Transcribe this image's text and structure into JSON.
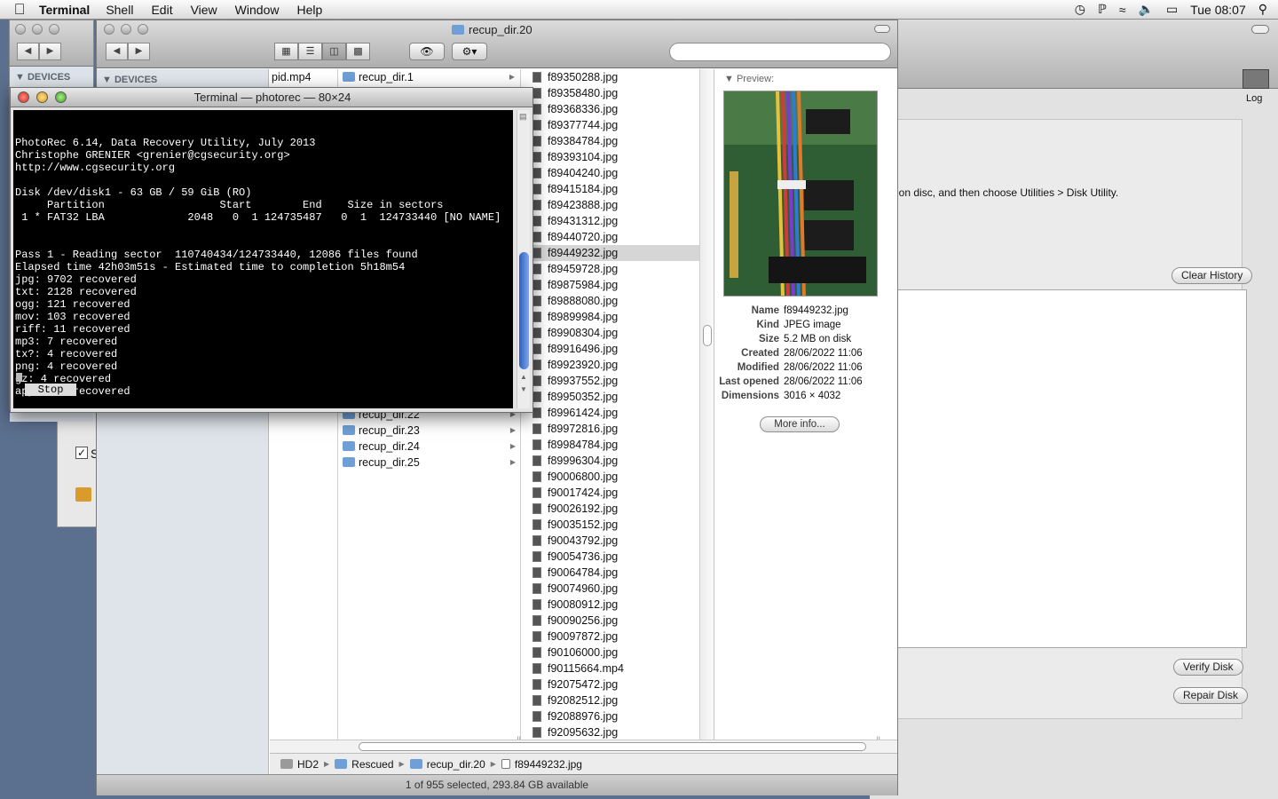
{
  "menubar": {
    "apple": "",
    "app": "Terminal",
    "items": [
      "Shell",
      "Edit",
      "View",
      "Window",
      "Help"
    ],
    "clock": "Tue 08:07"
  },
  "disk_utility": {
    "hint": "ion disc, and then choose Utilities > Disk Utility.",
    "clear_history": "Clear History",
    "verify": "Verify Disk",
    "repair": "Repair Disk",
    "log_label": "Log"
  },
  "back_finder": {
    "devices": "DEVICES"
  },
  "sysprefs": {
    "check_label": "S"
  },
  "finder": {
    "title": "recup_dir.20",
    "devices": "DEVICES",
    "search_value": "",
    "col1": [
      "pid.mp4"
    ],
    "col2_top": [
      "recup_dir.1"
    ],
    "col2_bottom": [
      "recup_dir.22",
      "recup_dir.23",
      "recup_dir.24",
      "recup_dir.25"
    ],
    "files": [
      "f89350288.jpg",
      "f89358480.jpg",
      "f89368336.jpg",
      "f89377744.jpg",
      "f89384784.jpg",
      "f89393104.jpg",
      "f89404240.jpg",
      "f89415184.jpg",
      "f89423888.jpg",
      "f89431312.jpg",
      "f89440720.jpg",
      "f89449232.jpg",
      "f89459728.jpg",
      "f89875984.jpg",
      "f89888080.jpg",
      "f89899984.jpg",
      "f89908304.jpg",
      "f89916496.jpg",
      "f89923920.jpg",
      "f89937552.jpg",
      "f89950352.jpg",
      "f89961424.jpg",
      "f89972816.jpg",
      "f89984784.jpg",
      "f89996304.jpg",
      "f90006800.jpg",
      "f90017424.jpg",
      "f90026192.jpg",
      "f90035152.jpg",
      "f90043792.jpg",
      "f90054736.jpg",
      "f90064784.jpg",
      "f90074960.jpg",
      "f90080912.jpg",
      "f90090256.jpg",
      "f90097872.jpg",
      "f90106000.jpg",
      "f90115664.mp4",
      "f92075472.jpg",
      "f92082512.jpg",
      "f92088976.jpg",
      "f92095632.jpg"
    ],
    "selected_index": 11,
    "preview": {
      "header": "Preview:",
      "info": [
        {
          "k": "Name",
          "v": "f89449232.jpg"
        },
        {
          "k": "Kind",
          "v": "JPEG image"
        },
        {
          "k": "Size",
          "v": "5.2 MB on disk"
        },
        {
          "k": "Created",
          "v": "28/06/2022 11:06"
        },
        {
          "k": "Modified",
          "v": "28/06/2022 11:06"
        },
        {
          "k": "Last opened",
          "v": "28/06/2022 11:06"
        },
        {
          "k": "Dimensions",
          "v": "3016 × 4032"
        }
      ],
      "more_info": "More info..."
    },
    "path": [
      "HD2",
      "Rescued",
      "recup_dir.20",
      "f89449232.jpg"
    ],
    "status": "1 of 955 selected, 293.84 GB available"
  },
  "terminal": {
    "title": "Terminal — photorec — 80×24",
    "lines": [
      "PhotoRec 6.14, Data Recovery Utility, July 2013",
      "Christophe GRENIER <grenier@cgsecurity.org>",
      "http://www.cgsecurity.org",
      "",
      "Disk /dev/disk1 - 63 GB / 59 GiB (RO)",
      "     Partition                  Start        End    Size in sectors",
      " 1 * FAT32 LBA             2048   0  1 124735487   0  1  124733440 [NO NAME]",
      "",
      "",
      "Pass 1 - Reading sector  110740434/124733440, 12086 files found",
      "Elapsed time 42h03m51s - Estimated time to completion 5h18m54",
      "jpg: 9702 recovered",
      "txt: 2128 recovered",
      "ogg: 121 recovered",
      "mov: 103 recovered",
      "riff: 11 recovered",
      "mp3: 7 recovered",
      "tx?: 4 recovered",
      "png: 4 recovered",
      "gz: 4 recovered",
      "apple: 2 recovered"
    ],
    "stop": "Stop"
  },
  "colors": {
    "desktop": "#5b6f8e",
    "terminal_bg": "#000000",
    "selection": "#d6d6d6",
    "folder": "#6e9fd6",
    "scroll_thumb": "#2b5fc2"
  }
}
